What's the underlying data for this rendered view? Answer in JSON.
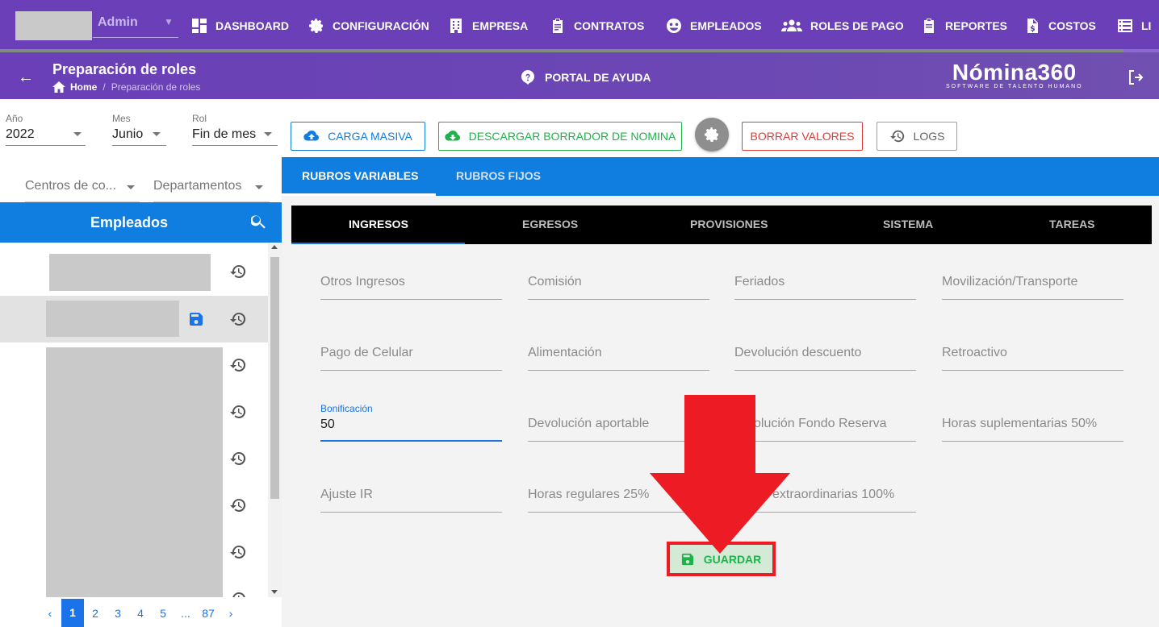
{
  "topnav": {
    "user_label": "Admin",
    "items": [
      {
        "label": "DASHBOARD",
        "icon": "dashboard-icon"
      },
      {
        "label": "CONFIGURACIÓN",
        "icon": "gear-icon"
      },
      {
        "label": "EMPRESA",
        "icon": "building-icon"
      },
      {
        "label": "CONTRATOS",
        "icon": "clipboard-icon"
      },
      {
        "label": "EMPLEADOS",
        "icon": "employees-icon"
      },
      {
        "label": "ROLES DE PAGO",
        "icon": "people-group-icon"
      },
      {
        "label": "REPORTES",
        "icon": "report-icon"
      },
      {
        "label": "COSTOS",
        "icon": "cost-document-icon"
      },
      {
        "label": "LI",
        "icon": "list-icon"
      }
    ]
  },
  "subheader": {
    "title": "Preparación de roles",
    "breadcrumb_home": "Home",
    "breadcrumb_sep": "/",
    "breadcrumb_current": "Preparación de roles",
    "help_label": "PORTAL DE AYUDA",
    "logo_text": "Nómina360",
    "logo_tagline": "SOFTWARE DE TALENTO HUMANO"
  },
  "filters": {
    "year": {
      "label": "Año",
      "value": "2022"
    },
    "month": {
      "label": "Mes",
      "value": "Junio"
    },
    "role": {
      "label": "Rol",
      "value": "Fin de mes"
    },
    "cost_centers_placeholder": "Centros de co...",
    "departments_placeholder": "Departamentos"
  },
  "actions": {
    "bulk_upload": "CARGA MASIVA",
    "download_draft": "DESCARGAR BORRADOR DE NOMINA",
    "delete_values": "BORRAR VALORES",
    "logs": "LOGS"
  },
  "colors": {
    "primary": "#6a3fb7",
    "blue": "#0f7ee0",
    "green": "#1fb24a",
    "danger": "#e53935",
    "annotation_red": "#ed1c24"
  },
  "employees": {
    "title": "Empleados",
    "pagination": [
      "1",
      "2",
      "3",
      "4",
      "5",
      "...",
      "87"
    ],
    "current_page": "1"
  },
  "tabs_main": [
    {
      "label": "RUBROS VARIABLES",
      "active": true
    },
    {
      "label": "RUBROS FIJOS",
      "active": false
    }
  ],
  "tabs_sub": [
    {
      "label": "INGRESOS",
      "active": true
    },
    {
      "label": "EGRESOS",
      "active": false
    },
    {
      "label": "PROVISIONES",
      "active": false
    },
    {
      "label": "SISTEMA",
      "active": false
    },
    {
      "label": "TAREAS",
      "active": false
    }
  ],
  "fields": {
    "otros_ingresos": "Otros Ingresos",
    "comision": "Comisión",
    "feriados": "Feriados",
    "movilizacion": "Movilización/Transporte",
    "pago_celular": "Pago de Celular",
    "alimentacion": "Alimentación",
    "devolucion_descuento": "Devolución descuento",
    "retroactivo": "Retroactivo",
    "bonificacion_label": "Bonificación",
    "bonificacion_value": "50",
    "devolucion_aportable": "Devolución aportable",
    "devolucion_fondo_reserva": "olución Fondo Reserva",
    "horas_suplementarias": "Horas suplementarias 50%",
    "ajuste_ir": "Ajuste IR",
    "horas_regulares": "Horas regulares 25%",
    "horas_extraordinarias": "extraordinarias 100%"
  },
  "save_label": "GUARDAR"
}
